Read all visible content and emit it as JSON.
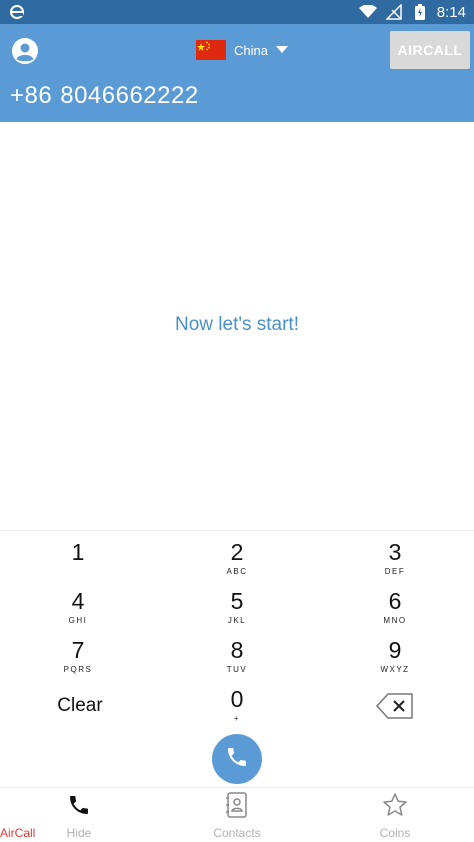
{
  "status_bar": {
    "time": "8:14",
    "icons": [
      "browser-e-icon",
      "wifi-icon",
      "no-signal-icon",
      "battery-icon"
    ]
  },
  "header": {
    "country": {
      "name": "China",
      "flag": "china-flag-icon"
    },
    "aircall_button": "AIRCALL",
    "phone": {
      "country_code": "+86",
      "number": "8046662222"
    },
    "colors": {
      "bar": "#5b9bd5",
      "status_bar": "#2f6aa1"
    }
  },
  "main": {
    "message": "Now let's start!"
  },
  "keypad": {
    "keys": [
      {
        "digit": "1",
        "letters": ""
      },
      {
        "digit": "2",
        "letters": "ABC"
      },
      {
        "digit": "3",
        "letters": "DEF"
      },
      {
        "digit": "4",
        "letters": "GHI"
      },
      {
        "digit": "5",
        "letters": "JKL"
      },
      {
        "digit": "6",
        "letters": "MNO"
      },
      {
        "digit": "7",
        "letters": "PQRS"
      },
      {
        "digit": "8",
        "letters": "TUV"
      },
      {
        "digit": "9",
        "letters": "WXYZ"
      },
      {
        "digit": "0",
        "letters": "+"
      }
    ],
    "clear_label": "Clear",
    "backspace_icon": "backspace-icon",
    "call_icon": "phone-icon"
  },
  "bottom_nav": {
    "items": [
      {
        "label": "Hide",
        "icon": "phone-icon"
      },
      {
        "label": "Contacts",
        "icon": "contacts-icon"
      },
      {
        "label": "Coins",
        "icon": "star-icon"
      }
    ],
    "app_label": "AirCall",
    "app_label_color": "#e53935"
  }
}
